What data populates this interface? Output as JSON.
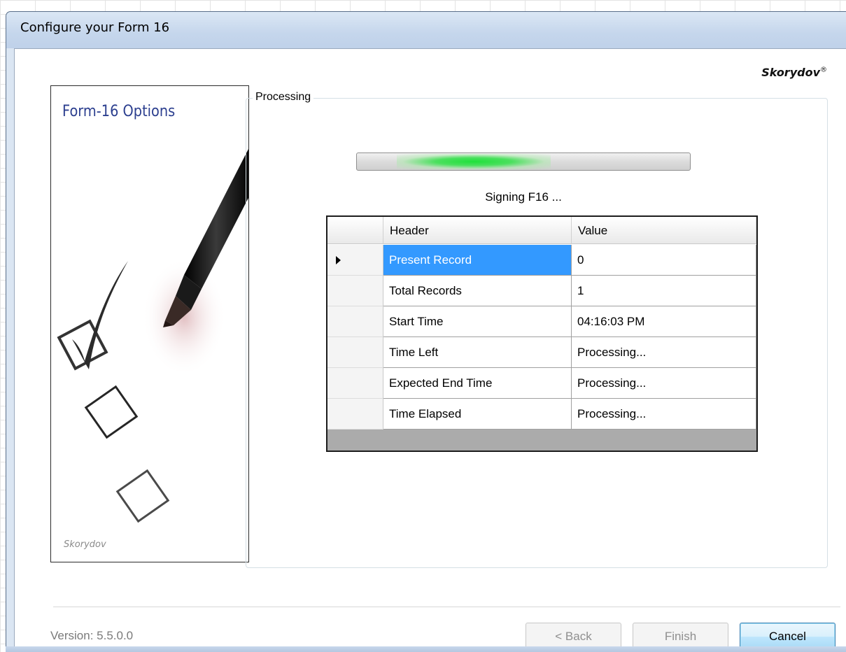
{
  "window": {
    "title": "Configure your Form 16"
  },
  "header": {
    "brand": "Skorydov",
    "brand_mark": "®"
  },
  "side_panel": {
    "title": "Form-16 Options",
    "brand": "Skorydov",
    "illustration": "marker-pen-and-checkboxes"
  },
  "processing": {
    "group_label": "Processing",
    "progress_fraction": 0.35,
    "status": "Signing F16 ..."
  },
  "grid": {
    "columns": [
      "Header",
      "Value"
    ],
    "selected_row": 0,
    "rows": [
      {
        "header": "Present Record",
        "value": "0"
      },
      {
        "header": "Total Records",
        "value": "1"
      },
      {
        "header": "Start Time",
        "value": "04:16:03 PM"
      },
      {
        "header": "Time Left",
        "value": "Processing..."
      },
      {
        "header": "Expected End Time",
        "value": "Processing..."
      },
      {
        "header": "Time Elapsed",
        "value": "Processing..."
      }
    ]
  },
  "footer": {
    "version": "Version: 5.5.0.0",
    "back_label": "< Back",
    "finish_label": "Finish",
    "cancel_label": "Cancel"
  },
  "colors": {
    "selection": "#3399ff",
    "progress": "#1fe13a",
    "side_title": "#2c3f8f"
  }
}
